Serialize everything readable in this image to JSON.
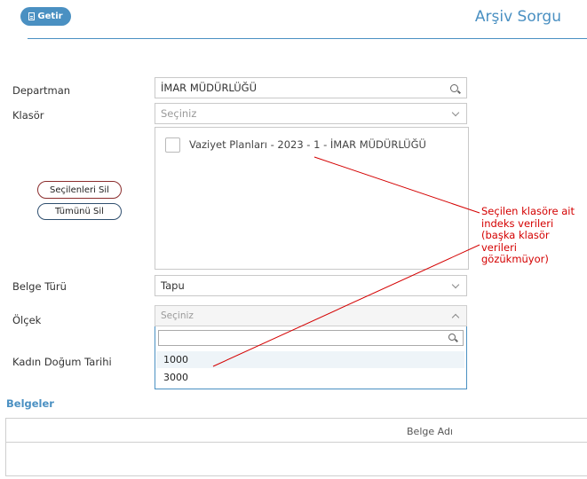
{
  "header": {
    "getir_label": "Getir",
    "title": "Arşiv Sorgu",
    "accent_color": "#4a90c2"
  },
  "form": {
    "departman": {
      "label": "Departman",
      "value": "İMAR MÜDÜRLÜĞÜ",
      "icon": "search-icon"
    },
    "klasor": {
      "label": "Klasör",
      "placeholder": "Seçiniz",
      "icon": "chevron-down-icon"
    },
    "klasor_list": {
      "items": [
        {
          "label": "Vaziyet Planları - 2023 - 1 - İMAR MÜDÜRLÜĞÜ",
          "checked": false
        }
      ]
    },
    "buttons": {
      "delete_selected": "Seçilenleri Sil",
      "delete_all": "Tümünü Sil"
    },
    "belge_turu": {
      "label": "Belge Türü",
      "value": "Tapu",
      "icon": "chevron-down-icon"
    },
    "olcek": {
      "label": "Ölçek",
      "placeholder": "Seçiniz",
      "icon": "chevron-up-icon",
      "search_value": "",
      "options": [
        "1000",
        "3000"
      ],
      "highlighted_option": "1000"
    },
    "kadin_dogum_tarihi": {
      "label": "Kadın Doğum Tarihi"
    }
  },
  "annotation": {
    "text": "Seçilen klasöre ait indeks verileri (başka klasör verileri gözükmüyor)",
    "color": "#d40000"
  },
  "belgeler": {
    "title": "Belgeler",
    "columns": [
      "Belge Adı"
    ],
    "rows": []
  }
}
